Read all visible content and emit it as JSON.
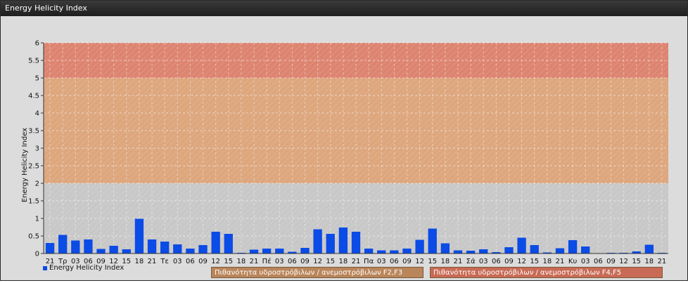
{
  "header": {
    "title": "Energy Helicity Index"
  },
  "legend": {
    "series_label": "Energy Helicity Index"
  },
  "bands": {
    "f2f3": {
      "label": "Πιθανότητα υδροστρόβιλων / ανεμοστρόβιλων F2,F3",
      "from": 2,
      "to": 5,
      "color": "#e0a070"
    },
    "f4f5": {
      "label": "Πιθανότητα υδροστρόβιλων / ανεμοστρόβιλων F4,F5",
      "from": 5,
      "to": 6,
      "color": "#e07860"
    }
  },
  "colors": {
    "bar": "#0b4be6",
    "plot_bg": "#c8c8c8",
    "grid": "#ffffff"
  },
  "chart_data": {
    "type": "bar",
    "title": "Energy Helicity Index",
    "ylabel": "Energy Helicity Index",
    "xlabel": "",
    "ylim": [
      0,
      6
    ],
    "yticks": [
      "0",
      "0.5",
      "1",
      "1.5",
      "2",
      "2.5",
      "3",
      "3.5",
      "4",
      "4.5",
      "5",
      "5.5",
      "6"
    ],
    "grid": true,
    "legend_position": "bottom-left",
    "categories": [
      "21",
      "Τρ",
      "03",
      "06",
      "09",
      "12",
      "15",
      "18",
      "21",
      "Τε",
      "03",
      "06",
      "09",
      "12",
      "15",
      "18",
      "21",
      "Πέ",
      "03",
      "06",
      "09",
      "12",
      "15",
      "18",
      "21",
      "Πα",
      "03",
      "06",
      "09",
      "12",
      "15",
      "18",
      "21",
      "Σά",
      "03",
      "06",
      "09",
      "12",
      "15",
      "18",
      "21",
      "Κυ",
      "03",
      "06",
      "09",
      "12",
      "15",
      "18",
      "21"
    ],
    "series": [
      {
        "name": "Energy Helicity Index",
        "values": [
          0.3,
          0.53,
          0.37,
          0.4,
          0.13,
          0.22,
          0.12,
          0.99,
          0.4,
          0.34,
          0.26,
          0.14,
          0.24,
          0.62,
          0.56,
          0.02,
          0.11,
          0.14,
          0.14,
          0.05,
          0.16,
          0.69,
          0.56,
          0.74,
          0.62,
          0.14,
          0.09,
          0.09,
          0.14,
          0.39,
          0.71,
          0.29,
          0.09,
          0.08,
          0.12,
          0.04,
          0.18,
          0.45,
          0.24,
          0.03,
          0.15,
          0.38,
          0.2,
          0.01,
          0.02,
          0.02,
          0.06,
          0.25,
          0.02
        ]
      }
    ]
  }
}
